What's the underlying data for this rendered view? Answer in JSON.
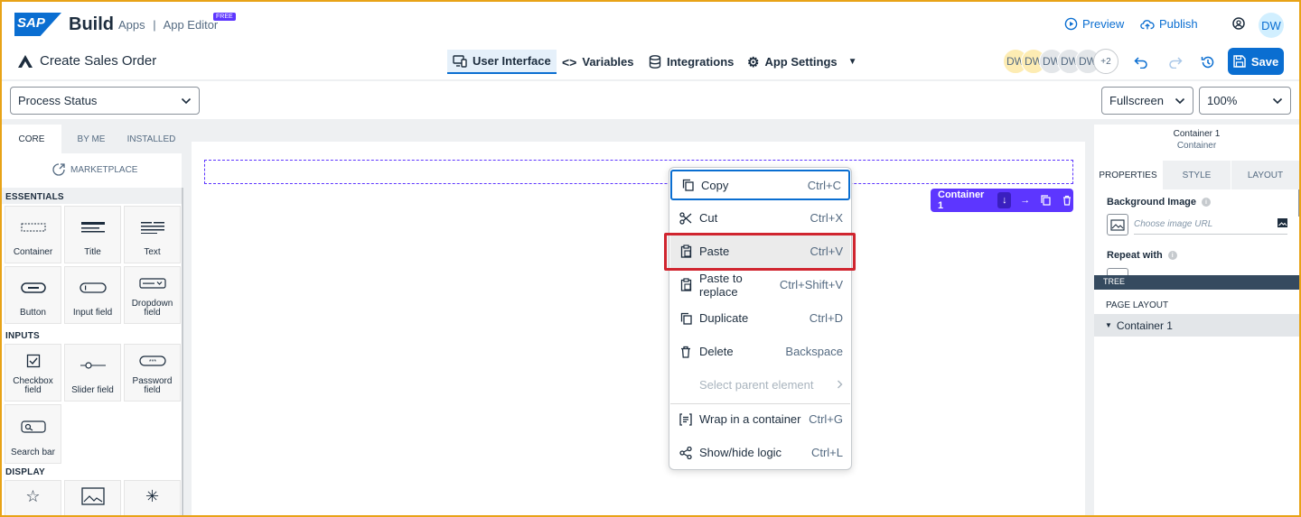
{
  "header": {
    "logo": "SAP",
    "brand": "Build",
    "crumb_apps": "Apps",
    "crumb_sep": "|",
    "crumb_editor": "App Editor",
    "badge": "FREE",
    "preview": "Preview",
    "publish": "Publish",
    "user_initials": "DW",
    "app_title": "Create Sales Order",
    "tabs": [
      "User Interface",
      "Variables",
      "Integrations",
      "App Settings"
    ],
    "collaborators": [
      "DW",
      "DW",
      "DW",
      "DW",
      "DW"
    ],
    "more_collaborators": "+2",
    "save": "Save"
  },
  "toolbar": {
    "page_select": "Process Status",
    "view_select": "Fullscreen",
    "zoom_select": "100%"
  },
  "left_panel": {
    "tabs": [
      "CORE",
      "BY ME",
      "INSTALLED"
    ],
    "marketplace": "MARKETPLACE",
    "sections": {
      "essentials": "ESSENTIALS",
      "inputs": "INPUTS",
      "display": "DISPLAY"
    },
    "essentials": [
      "Container",
      "Title",
      "Text",
      "Button",
      "Input field",
      "Dropdown field"
    ],
    "inputs": [
      "Checkbox field",
      "Slider field",
      "Password field",
      "Search bar"
    ]
  },
  "canvas": {
    "container_label": "Container 1"
  },
  "context_menu": {
    "items": [
      {
        "label": "Copy",
        "shortcut": "Ctrl+C"
      },
      {
        "label": "Cut",
        "shortcut": "Ctrl+X"
      },
      {
        "label": "Paste",
        "shortcut": "Ctrl+V"
      },
      {
        "label": "Paste to replace",
        "shortcut": "Ctrl+Shift+V"
      },
      {
        "label": "Duplicate",
        "shortcut": "Ctrl+D"
      },
      {
        "label": "Delete",
        "shortcut": "Backspace"
      },
      {
        "label": "Select parent element",
        "shortcut": ""
      },
      {
        "label": "Wrap in a container",
        "shortcut": "Ctrl+G"
      },
      {
        "label": "Show/hide logic",
        "shortcut": "Ctrl+L"
      }
    ]
  },
  "right_panel": {
    "title": "Container 1",
    "subtitle": "Container",
    "tabs": [
      "PROPERTIES",
      "STYLE",
      "LAYOUT"
    ],
    "background_image_label": "Background Image",
    "image_url_placeholder": "Choose image URL",
    "repeat_with_label": "Repeat with",
    "tree_label": "TREE",
    "page_layout": "PAGE LAYOUT",
    "tree_item": "Container 1"
  },
  "colors": {
    "accent": "#0a6ed1",
    "container_purple": "#5d36ff",
    "highlight_red": "#d0252f",
    "frame": "#e8a317"
  }
}
